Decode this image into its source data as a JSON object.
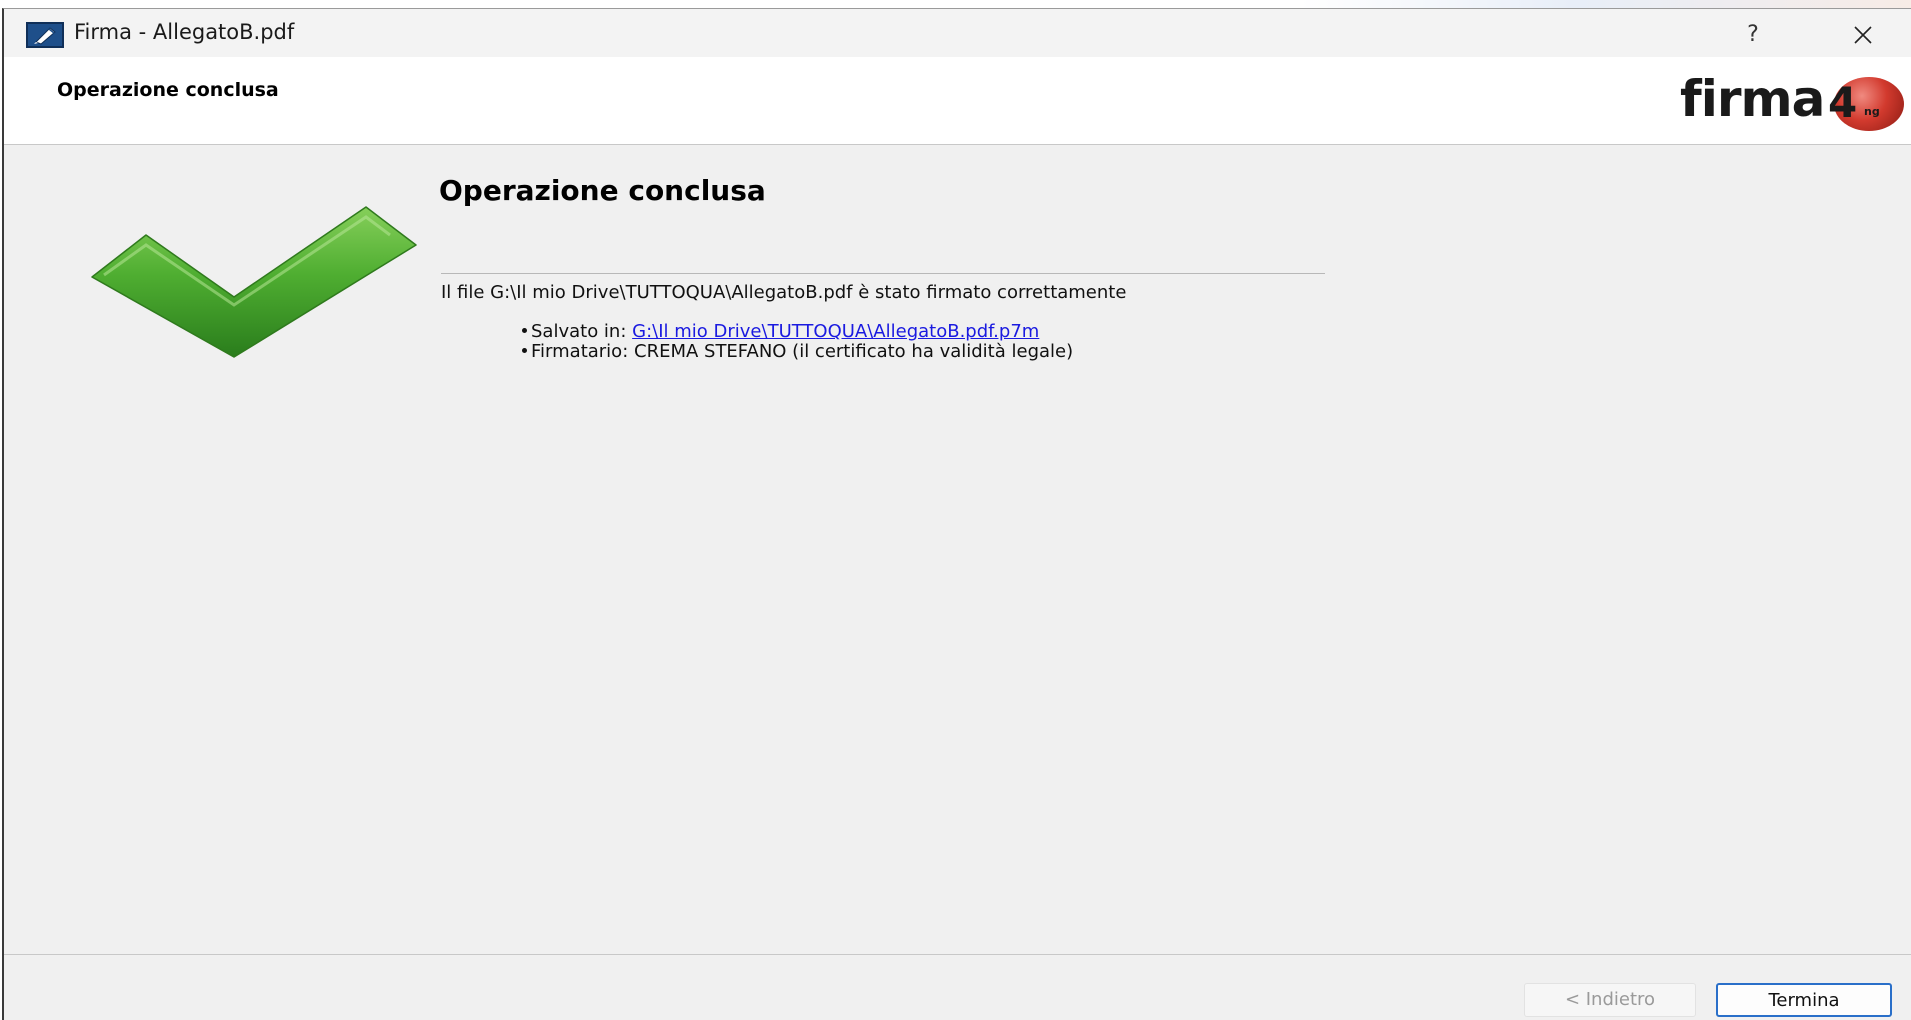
{
  "window": {
    "title": "Firma - AllegatoB.pdf",
    "help_label": "?",
    "app_icon": "pen-signature-icon",
    "close_icon": "close-icon"
  },
  "header": {
    "title": "Operazione conclusa",
    "logo_text": "firma",
    "logo_digit": "4",
    "logo_suffix": "ng"
  },
  "content": {
    "title": "Operazione conclusa",
    "status_icon": "checkmark-icon",
    "message": "Il file G:\\Il mio Drive\\TUTTOQUA\\AllegatoB.pdf è stato firmato correttamente",
    "saved_label": "Salvato in:",
    "saved_path": "G:\\Il mio Drive\\TUTTOQUA\\AllegatoB.pdf.p7m",
    "signer_label": "Firmatario:",
    "signer_value": "CREMA STEFANO (il certificato ha validità legale)"
  },
  "footer": {
    "back_label": "< Indietro",
    "finish_label": "Termina"
  },
  "colors": {
    "accent": "#2a6fc9",
    "link": "#1a1ae0",
    "success": "#3f9a2a",
    "window_bg": "#f0f0f0"
  }
}
